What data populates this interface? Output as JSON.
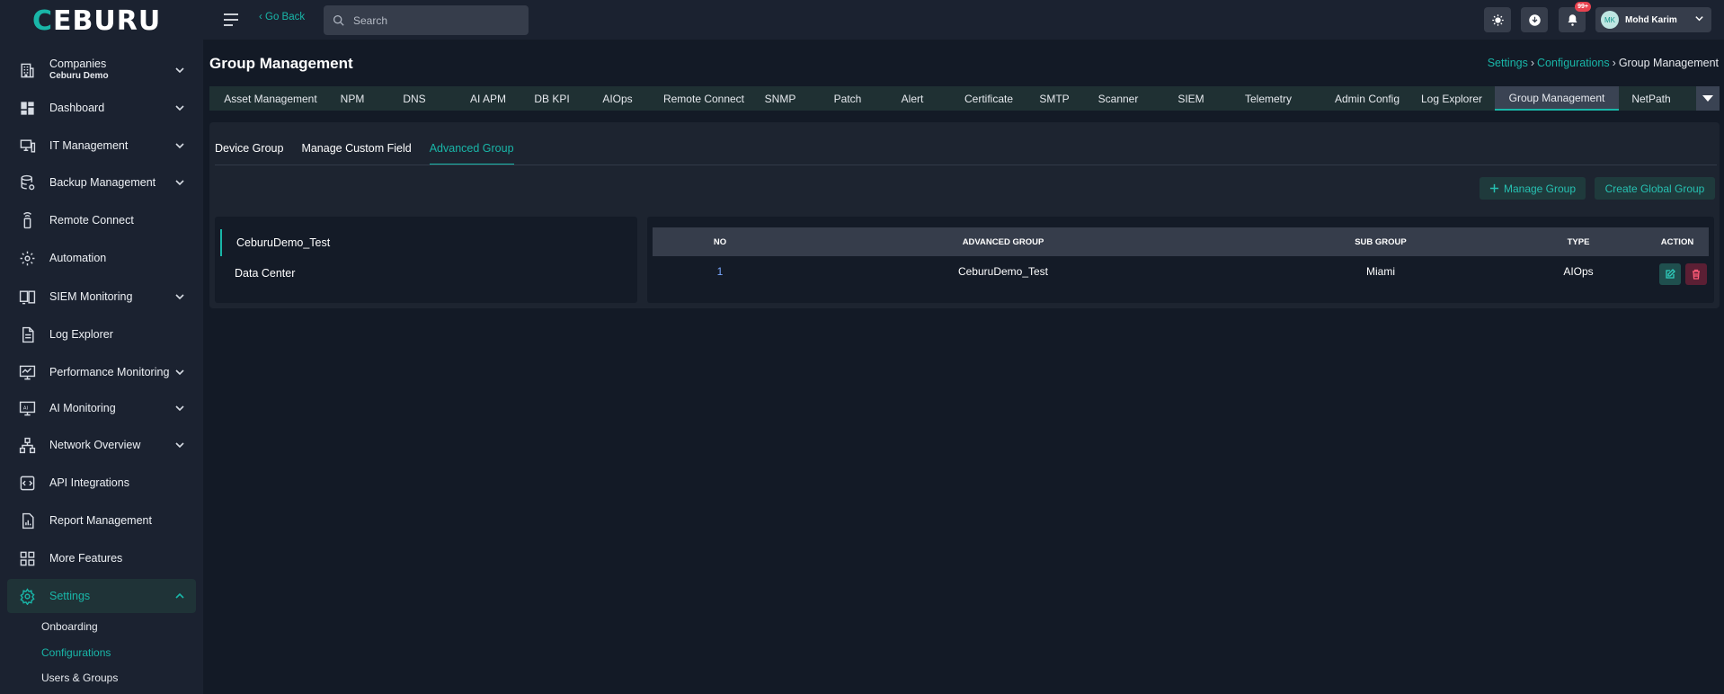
{
  "brand": {
    "logo_text": "CEBURU",
    "accent": "#19b6a8"
  },
  "sidebar": {
    "company": {
      "label": "Companies",
      "name": "Ceburu Demo"
    },
    "items": [
      {
        "label": "Dashboard",
        "icon": "dashboard-icon",
        "has_chevron": true
      },
      {
        "label": "IT Management",
        "icon": "it-management-icon",
        "has_chevron": true
      },
      {
        "label": "Backup Management",
        "icon": "backup-icon",
        "has_chevron": true
      },
      {
        "label": "Remote Connect",
        "icon": "remote-connect-icon",
        "has_chevron": false
      },
      {
        "label": "Automation",
        "icon": "automation-gear-icon",
        "has_chevron": false
      },
      {
        "label": "SIEM Monitoring",
        "icon": "siem-monitor-icon",
        "has_chevron": true
      },
      {
        "label": "Log Explorer",
        "icon": "document-icon",
        "has_chevron": false
      },
      {
        "label": "Performance Monitoring",
        "icon": "performance-monitor-icon",
        "has_chevron": true
      },
      {
        "label": "AI Monitoring",
        "icon": "ai-monitor-icon",
        "has_chevron": true
      },
      {
        "label": "Network Overview",
        "icon": "network-icon",
        "has_chevron": true
      },
      {
        "label": "API Integrations",
        "icon": "api-icon",
        "has_chevron": false
      },
      {
        "label": "Report Management",
        "icon": "report-icon",
        "has_chevron": false
      },
      {
        "label": "More Features",
        "icon": "grid-icon",
        "has_chevron": false
      },
      {
        "label": "Settings",
        "icon": "settings-gear-icon",
        "has_chevron": true,
        "active": true
      }
    ],
    "settings_subitems": [
      {
        "label": "Onboarding"
      },
      {
        "label": "Configurations",
        "active": true
      },
      {
        "label": "Users & Groups"
      }
    ]
  },
  "topbar": {
    "go_back": "‹ Go Back",
    "search_placeholder": "Search",
    "notification_badge": "99+",
    "user": {
      "initials": "MK",
      "name": "Mohd Karim"
    }
  },
  "page": {
    "title": "Group Management",
    "breadcrumb": [
      "Settings",
      "Configurations",
      "Group Management"
    ]
  },
  "module_tabs": [
    "Asset Management",
    "NPM",
    "DNS",
    "AI APM",
    "DB KPI",
    "AIOps",
    "Remote Connect",
    "SNMP",
    "Patch",
    "Alert",
    "Certificate",
    "SMTP",
    "Scanner",
    "SIEM",
    "Telemetry",
    "Admin Config",
    "Log Explorer",
    "Group Management",
    "NetPath"
  ],
  "module_tabs_active": "Group Management",
  "sub_tabs": [
    "Device Group",
    "Manage Custom Field",
    "Advanced Group"
  ],
  "sub_tabs_active": "Advanced Group",
  "actions": {
    "manage_group": "Manage Group",
    "create_global_group": "Create Global Group"
  },
  "group_list": [
    {
      "label": "CeburuDemo_Test",
      "active": true
    },
    {
      "label": "Data Center",
      "active": false
    }
  ],
  "table": {
    "headers": {
      "no": "NO",
      "advanced_group": "ADVANCED GROUP",
      "sub_group": "SUB GROUP",
      "type": "TYPE",
      "action": "ACTION"
    },
    "rows": [
      {
        "no": "1",
        "advanced_group": "CeburuDemo_Test",
        "sub_group": "Miami",
        "type": "AIOps"
      }
    ]
  }
}
